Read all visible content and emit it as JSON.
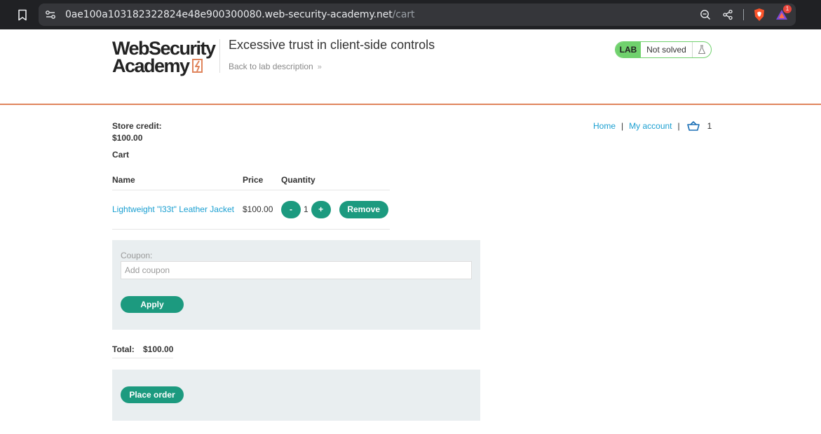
{
  "browser": {
    "url_host": "0ae100a103182322824e48e900300080.web-security-academy.net",
    "url_path": "/cart",
    "notification_count": "1",
    "icons": [
      "bookmark-icon",
      "site-info-icon",
      "zoom-out-icon",
      "share-icon",
      "brave-shield-icon",
      "brave-rewards-icon"
    ]
  },
  "lab_header": {
    "logo_line1": "WebSecurity",
    "logo_line2": "Academy",
    "title": "Excessive trust in client-side controls",
    "back_link": "Back to lab description",
    "lab_tag": "LAB",
    "status": "Not solved",
    "colors": {
      "accent": "#e0845c",
      "lab_green": "#70d16d"
    }
  },
  "nav": {
    "home": "Home",
    "sep1": "|",
    "account": "My account",
    "sep2": "|",
    "cart_count": "1"
  },
  "store": {
    "credit_label": "Store credit:",
    "credit_value": "$100.00",
    "cart_heading": "Cart"
  },
  "cart": {
    "columns": [
      "Name",
      "Price",
      "Quantity"
    ],
    "items": [
      {
        "name": "Lightweight \"l33t\" Leather Jacket",
        "price": "$100.00",
        "quantity": "1",
        "decrease_label": "-",
        "increase_label": "+",
        "remove_label": "Remove"
      }
    ]
  },
  "coupon": {
    "label": "Coupon:",
    "placeholder": "Add coupon",
    "value": "",
    "apply_label": "Apply"
  },
  "total": {
    "label": "Total:",
    "value": "$100.00"
  },
  "order": {
    "place_order_label": "Place order"
  },
  "theme": {
    "button_color": "#1c9a7f",
    "link_color": "#1a9fd1",
    "panel_color": "#e9eef0"
  }
}
